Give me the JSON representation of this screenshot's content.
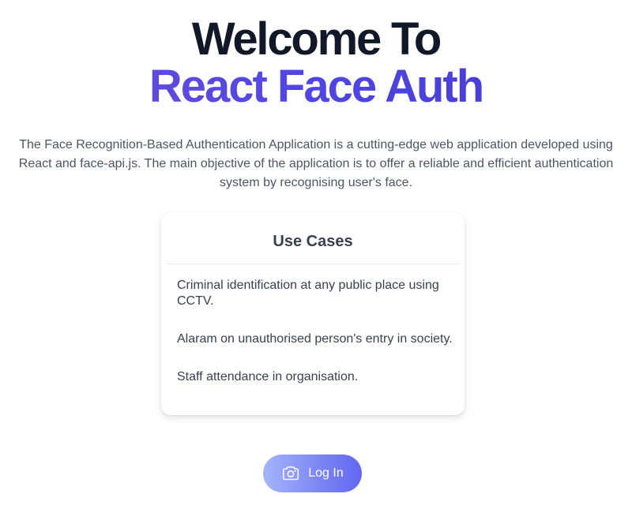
{
  "hero": {
    "title_line_1": "Welcome To",
    "title_line_2": "React Face Auth",
    "description": "The Face Recognition-Based Authentication Application is a cutting-edge web application developed using React and face-api.js. The main objective of the application is to offer a reliable and efficient authentication system by recognising user's face."
  },
  "use_cases": {
    "title": "Use Cases",
    "items": [
      "Criminal identification at any public place using CCTV.",
      "Alaram on unauthorised person's entry in society.",
      "Staff attendance in organisation."
    ]
  },
  "login": {
    "label": "Log In",
    "icon": "camera-icon"
  },
  "colors": {
    "title_primary": "#111827",
    "title_accent": "#4f46e5",
    "button_gradient_start": "#a5b4fc",
    "button_gradient_end": "#6366f1"
  }
}
